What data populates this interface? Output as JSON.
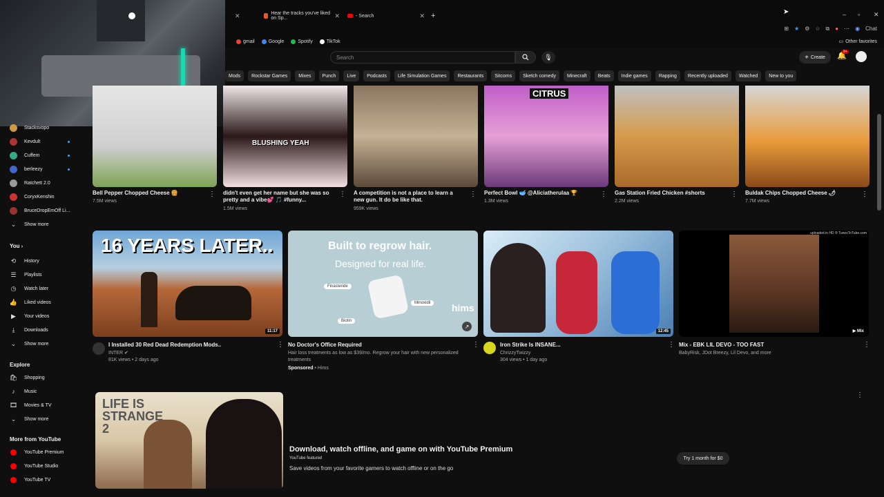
{
  "browser": {
    "tabs": [
      {
        "label": "Hear the tracks you've liked on Sp..."
      },
      {
        "label": "- Search"
      }
    ],
    "bookmarks": [
      {
        "label": "gmail",
        "color": "#ea4335"
      },
      {
        "label": "Google",
        "color": "#4285f4"
      },
      {
        "label": "Spotify",
        "color": "#1db954"
      },
      {
        "label": "TikTok",
        "color": "#ffffff"
      }
    ],
    "other_favorites": "Other favorites",
    "chat": "Chat"
  },
  "header": {
    "search_placeholder": "Search",
    "create_label": "Create",
    "notif_count": "9+"
  },
  "chips": [
    "Mods",
    "Rockstar Games",
    "Mixes",
    "Punch",
    "Live",
    "Podcasts",
    "Life Simulation Games",
    "Restaurants",
    "Sitcoms",
    "Sketch comedy",
    "Minecraft",
    "Beats",
    "Indie games",
    "Rapping",
    "Recently uploaded",
    "Watched",
    "New to you"
  ],
  "sidebar": {
    "channels": [
      {
        "label": "Stacksvopo",
        "color": "#c94",
        "live": false
      },
      {
        "label": "Kevdult",
        "color": "#a33",
        "live": true
      },
      {
        "label": "Cuffem",
        "color": "#3a8",
        "live": true
      },
      {
        "label": "berleezy",
        "color": "#46c",
        "live": true
      },
      {
        "label": "Ratchett 2.0",
        "color": "#999",
        "live": false
      },
      {
        "label": "CoryxKenshin",
        "color": "#c33",
        "live": false
      },
      {
        "label": "BruceDropEmOff Li...",
        "color": "#933",
        "live": false
      }
    ],
    "show_more_1": "Show more",
    "you_label": "You",
    "you_items": [
      {
        "label": "History",
        "icon": "history-icon",
        "glyph": "⟲"
      },
      {
        "label": "Playlists",
        "icon": "playlists-icon",
        "glyph": "☰"
      },
      {
        "label": "Watch later",
        "icon": "watch-later-icon",
        "glyph": "◷"
      },
      {
        "label": "Liked videos",
        "icon": "like-icon",
        "glyph": "👍"
      },
      {
        "label": "Your videos",
        "icon": "your-videos-icon",
        "glyph": "▶"
      },
      {
        "label": "Downloads",
        "icon": "download-icon",
        "glyph": "⤓"
      }
    ],
    "show_more_2": "Show more",
    "explore_label": "Explore",
    "explore_items": [
      {
        "label": "Shopping",
        "icon": "shopping-icon",
        "glyph": "🛍"
      },
      {
        "label": "Music",
        "icon": "music-icon",
        "glyph": "♪"
      },
      {
        "label": "Movies & TV",
        "icon": "movies-icon",
        "glyph": "🎞"
      }
    ],
    "show_more_3": "Show more",
    "more_label": "More from YouTube",
    "more_items": [
      {
        "label": "YouTube Premium",
        "color": "#ff0000"
      },
      {
        "label": "YouTube Studio",
        "color": "#ff0000"
      },
      {
        "label": "YouTube TV",
        "color": "#ff0000"
      }
    ]
  },
  "shorts": [
    {
      "title": "Bell Pepper Chopped Cheese 🍔",
      "views": "7.5M views"
    },
    {
      "title": "didn't even get her name but she was so pretty and a vibe💕 🎵 #funny...",
      "views": "1.5M views",
      "overlay": "BLUSHING YEAH"
    },
    {
      "title": "A competition is not a place to learn a new gun. It do be like that.",
      "views": "959K views"
    },
    {
      "title": "Perfect Bowl 🥣 @Aliciatherulaa 🏆",
      "views": "1.3M views",
      "overlay": "CITRUS"
    },
    {
      "title": "Gas Station Fried Chicken #shorts",
      "views": "2.2M views"
    },
    {
      "title": "Buldak Chips Chopped Cheese 🌶",
      "views": "7.7M views"
    }
  ],
  "videos": [
    {
      "title": "I Installed 30 Red Dead Redemption Mods..",
      "channel": "INTER",
      "meta": "81K views • 2 days ago",
      "duration": "11:17",
      "overlay": "16 YEARS LATER.."
    },
    {
      "title": "No Doctor's Office Required",
      "desc": "Hair loss treatments as low as $39/mo. Regrow your hair with new personalized treatments",
      "sponsored": "Sponsored",
      "sponsor": "Hims",
      "ad_line1": "Built to regrow hair.",
      "ad_line2": "Designed for real life.",
      "ad_label1": "Finasteride",
      "ad_label2": "Minoxidil",
      "ad_label3": "Biotin",
      "ad_brand": "hims"
    },
    {
      "title": "Iron Strike Is INSANE...",
      "channel": "ChrizzyTwizzy",
      "meta": "304 views • 1 day ago",
      "duration": "12:45"
    },
    {
      "title": "Mix - EBK LIL DEVO - TOO FAST",
      "channel": "BabyRisk, JDot Breezy, Lil Devo, and more",
      "duration": "Mix",
      "overlay": "uploaded in HD ® TunesToTube.com"
    }
  ],
  "premium": {
    "title": "Download, watch offline, and game on with YouTube Premium",
    "badge": "YouTube featured",
    "subtitle": "Save videos from your favorite gamers to watch offline or on the go",
    "cta": "Try 1 month for $0",
    "thumb_text": "LIFE IS STRANGE 2"
  }
}
